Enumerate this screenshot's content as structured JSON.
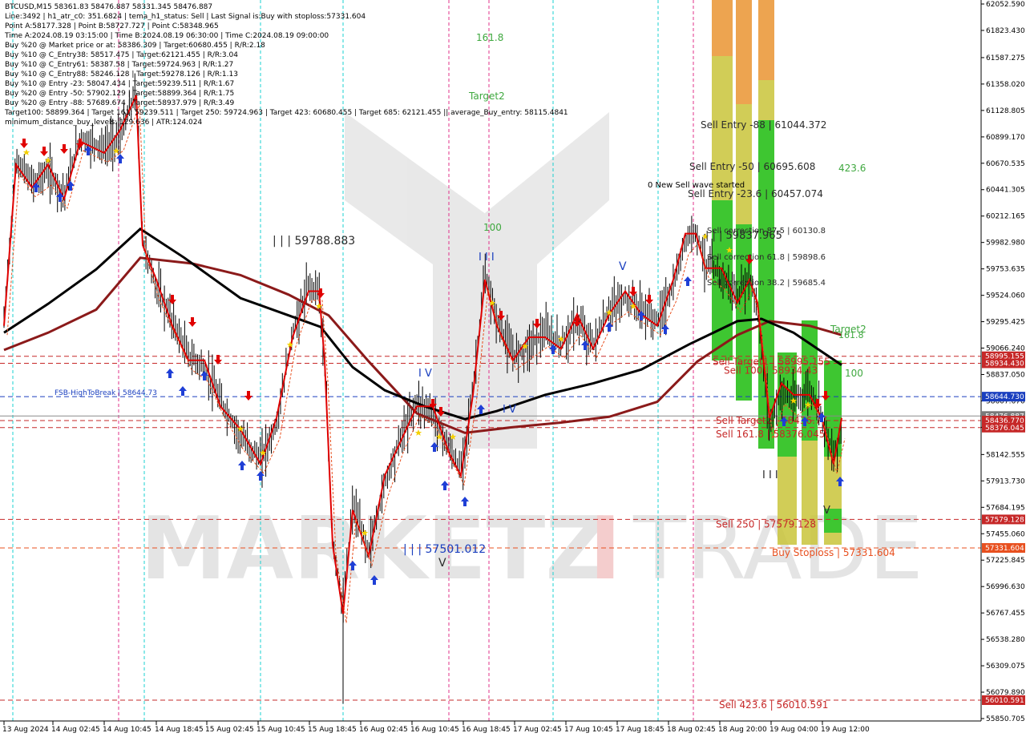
{
  "header": {
    "symbol_line": "BTCUSD,M15  58361.83 58476.887 58331.345 58476.887",
    "info_lines": [
      "Line:3492 | h1_atr_c0: 351.6824 | tema_h1_status: Sell | Last Signal is:Buy with stoploss:57331.604",
      "Point A:58177.328 | Point B:58727.727 | Point C:58348.965",
      "Time A:2024.08.19 03:15:00 | Time B:2024.08.19 06:30:00 | Time C:2024.08.19 09:00:00",
      "Buy %20 @ Market price or at: 58386.309 | Target:60680.455 | R/R:2.18",
      "Buy %10 @ C_Entry38: 58517.475 | Target:62121.455 | R/R:3.04",
      "Buy %10 @ C_Entry61: 58387.58 | Target:59724.963 | R/R:1.27",
      "Buy %10 @ C_Entry88: 58246.128 | Target:59278.126 | R/R:1.13",
      "Buy %10 @ Entry -23: 58047.434 | Target:59239.511 | R/R:1.67",
      "Buy %20 @ Entry -50: 57902.129 | Target:58899.364 | R/R:1.75",
      "Buy %20 @ Entry -88: 57689.674 | Target:58937.979 | R/R:3.49",
      "Target100: 58899.364 | Target 161: 59239.511 | Target 250: 59724.963 | Target 423: 60680.455 | Target 685: 62121.455 || average_Buy_entry: 58115.4841",
      "minimum_distance_buy_levels: 129.636 | ATR:124.024"
    ],
    "wave_title": "0 New Sell wave started"
  },
  "price_axis": {
    "ticks": [
      "62052.590",
      "61823.430",
      "61587.275",
      "61358.020",
      "61128.805",
      "60899.170",
      "60670.535",
      "60441.305",
      "60212.165",
      "59982.980",
      "59753.635",
      "59524.060",
      "59295.425",
      "59066.240",
      "58837.050",
      "58607.670",
      "58378.465",
      "58142.555",
      "57913.730",
      "57684.195",
      "57455.060",
      "57225.845",
      "56996.630",
      "56767.455",
      "56538.280",
      "56309.075",
      "56079.890",
      "55850.705"
    ],
    "badges": [
      {
        "text": "58995.155",
        "value": 58995.155,
        "color": "#c62828"
      },
      {
        "text": "58934.430",
        "value": 58934.43,
        "color": "#c62828"
      },
      {
        "text": "58644.730",
        "value": 58644.73,
        "color": "#1a3fbf"
      },
      {
        "text": "58476.887",
        "value": 58476.887,
        "color": "#7a7a7a"
      },
      {
        "text": "58436.770",
        "value": 58436.77,
        "color": "#c62828"
      },
      {
        "text": "58376.045",
        "value": 58376.045,
        "color": "#c62828"
      },
      {
        "text": "57579.128",
        "value": 57579.128,
        "color": "#c62828"
      },
      {
        "text": "57331.604",
        "value": 57331.604,
        "color": "#e8501f"
      },
      {
        "text": "56010.591",
        "value": 56010.591,
        "color": "#c62828"
      }
    ]
  },
  "time_axis": {
    "ticks": [
      "13 Aug 2024",
      "14 Aug 02:45",
      "14 Aug 10:45",
      "14 Aug 18:45",
      "15 Aug 02:45",
      "15 Aug 10:45",
      "15 Aug 18:45",
      "16 Aug 02:45",
      "16 Aug 10:45",
      "16 Aug 18:45",
      "17 Aug 02:45",
      "17 Aug 10:45",
      "17 Aug 18:45",
      "18 Aug 02:45",
      "18 Aug 20:00",
      "19 Aug 04:00",
      "19 Aug 12:00"
    ]
  },
  "levels": [
    {
      "label": "FSB-HighToBreak | 58644.73",
      "value": 58644.73,
      "color": "#1a3fbf",
      "style": "dash"
    },
    {
      "label": "Sell 250 | 57579.128",
      "value": 57579.128,
      "color": "#c62828",
      "style": "dash"
    },
    {
      "label": "Buy Stoploss | 57331.604",
      "value": 57331.604,
      "color": "#e8501f",
      "style": "dash"
    },
    {
      "label": "Sell 423.6 | 56010.591",
      "value": 56010.591,
      "color": "#c62828",
      "style": "dash"
    },
    {
      "label": "Sell 100 | 58934.43",
      "value": 58934.43,
      "color": "#c62828",
      "style": "dash"
    },
    {
      "label": "Sell Target1 | 58995.155",
      "value": 58995.155,
      "color": "#c62828",
      "style": "dash"
    },
    {
      "label": "Sell 161.8 | 58376.045",
      "value": 58376.045,
      "color": "#c62828",
      "style": "dash"
    },
    {
      "label": "Sell Target2 | 58436.77",
      "value": 58436.77,
      "color": "#c62828",
      "style": "dash"
    }
  ],
  "annotations": {
    "sell_entry_88": "Sell Entry -88 | 61044.372",
    "sell_entry_50": "Sell Entry -50 | 60695.608",
    "sell_entry_23": "Sell Entry -23.6 | 60457.074",
    "sell_corr_87": "Sell correction 87.5 | 60130.8",
    "sell_corr_61": "Sell correction 61.8 | 59898.6",
    "sell_corr_38": "Sell correction 38.2 | 59685.4",
    "peak_label": "| | | 59837.965",
    "label_59788": "| | | 59788.883",
    "label_57501": "| | | 57501.012",
    "fib_161": "161.8",
    "fib_target2": "Target2",
    "fib_100": "100",
    "fib_4236": "423.6",
    "fib_target2_right": "Target2",
    "fib_1618_right": "161.8",
    "fib_100_right": "100",
    "wave_iii_top": "I I I",
    "wave_iv": "I V",
    "wave_v_top": "V",
    "wave_v_low": "V",
    "wave_iii_right": "I I I",
    "wave_v_right": "V",
    "wave_iv_top": "I V"
  },
  "watermark": {
    "text_left": "MARKETZ",
    "text_mid": "I",
    "text_right": "TRADE"
  },
  "colors": {
    "ma_black": "#000000",
    "ma_dark_red": "#8b1a1a",
    "tema_red": "#e00000",
    "buy_arrow": "#1f3fd6",
    "sell_arrow": "#e00000",
    "green_zone": "#2ec52e",
    "yellow_zone": "#c9c43a",
    "orange_zone": "#f0a050"
  }
}
